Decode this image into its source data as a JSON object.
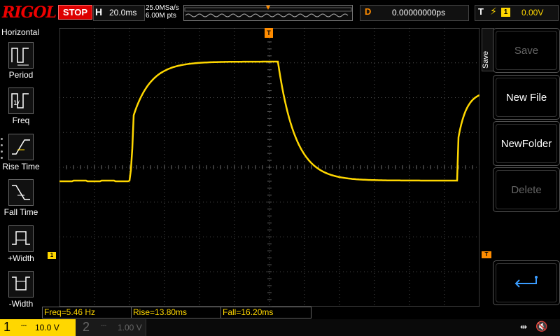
{
  "brand": "RIGOL",
  "run_state": "STOP",
  "horizontal": {
    "key": "H",
    "timebase": "20.0ms"
  },
  "sampling": {
    "rate": "25.0MSa/s",
    "memory": "6.00M pts"
  },
  "delay": {
    "key": "D",
    "value": "0.00000000ps"
  },
  "trigger": {
    "key": "T",
    "source": "1",
    "level": "0.00V",
    "marker": "T"
  },
  "left_menu": {
    "title": "Horizontal",
    "items": [
      {
        "label": "Period",
        "icon": "period-icon"
      },
      {
        "label": "Freq",
        "icon": "frequency-icon"
      },
      {
        "label": "Rise Time",
        "icon": "rise-time-icon"
      },
      {
        "label": "Fall Time",
        "icon": "fall-time-icon"
      },
      {
        "label": "+Width",
        "icon": "positive-width-icon"
      },
      {
        "label": "-Width",
        "icon": "negative-width-icon"
      }
    ]
  },
  "right_menu": {
    "title": "Save",
    "softkeys": [
      {
        "label": "Save",
        "enabled": false
      },
      {
        "label": "New File",
        "enabled": true
      },
      {
        "label": "NewFolder",
        "enabled": true
      },
      {
        "label": "Delete",
        "enabled": false
      },
      {
        "label": "",
        "enabled": true,
        "icon": "return-icon"
      }
    ]
  },
  "measurements": [
    "Freq=5.46 Hz",
    "Rise=13.80ms",
    "Fall=16.20ms"
  ],
  "channels": [
    {
      "number": "1",
      "coupling": "DC",
      "scale": "10.0 V",
      "active": true
    },
    {
      "number": "2",
      "coupling": "DC",
      "scale": "1.00 V",
      "active": false
    }
  ],
  "ch1_marker": "1",
  "colors": {
    "ch1": "#ffd700",
    "trigger": "#ff8c00",
    "stop": "#dd0000",
    "grid": "#555555"
  }
}
